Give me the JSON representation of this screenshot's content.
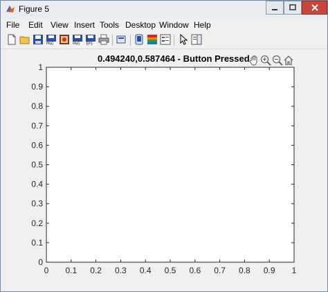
{
  "window": {
    "title": "Figure 5"
  },
  "menu": [
    "File",
    "Edit",
    "View",
    "Insert",
    "Tools",
    "Desktop",
    "Window",
    "Help"
  ],
  "toolbar": {
    "icons": [
      "new-figure-icon",
      "open-file-icon",
      "save-icon",
      "save-png-icon",
      "save-pdf-icon",
      "save-png2-icon",
      "save-eps-icon",
      "print-icon",
      "print-preview-icon",
      "data-cursor-icon",
      "colorbar-icon",
      "legend-icon",
      "pointer-icon",
      "property-editor-icon"
    ]
  },
  "axes": {
    "title": "0.494240,0.587464 - Button Pressed",
    "x_ticks": [
      "0",
      "0.1",
      "0.2",
      "0.3",
      "0.4",
      "0.5",
      "0.6",
      "0.7",
      "0.8",
      "0.9",
      "1"
    ],
    "y_ticks": [
      "0",
      "0.1",
      "0.2",
      "0.3",
      "0.4",
      "0.5",
      "0.6",
      "0.7",
      "0.8",
      "0.9",
      "1"
    ],
    "tools": [
      "pan-icon",
      "zoom-in-icon",
      "zoom-out-icon",
      "home-icon"
    ]
  },
  "chart_data": {
    "type": "scatter",
    "title": "0.494240,0.587464 - Button Pressed",
    "xlabel": "",
    "ylabel": "",
    "xlim": [
      0,
      1
    ],
    "ylim": [
      0,
      1
    ],
    "x_ticks": [
      0,
      0.1,
      0.2,
      0.3,
      0.4,
      0.5,
      0.6,
      0.7,
      0.8,
      0.9,
      1
    ],
    "y_ticks": [
      0,
      0.1,
      0.2,
      0.3,
      0.4,
      0.5,
      0.6,
      0.7,
      0.8,
      0.9,
      1
    ],
    "series": [],
    "grid": false
  },
  "colors": {
    "close_button": "#c7453a",
    "window_border": "#6f8aa8",
    "figure_background": "#f0f0f0",
    "axes_background": "#ffffff"
  }
}
